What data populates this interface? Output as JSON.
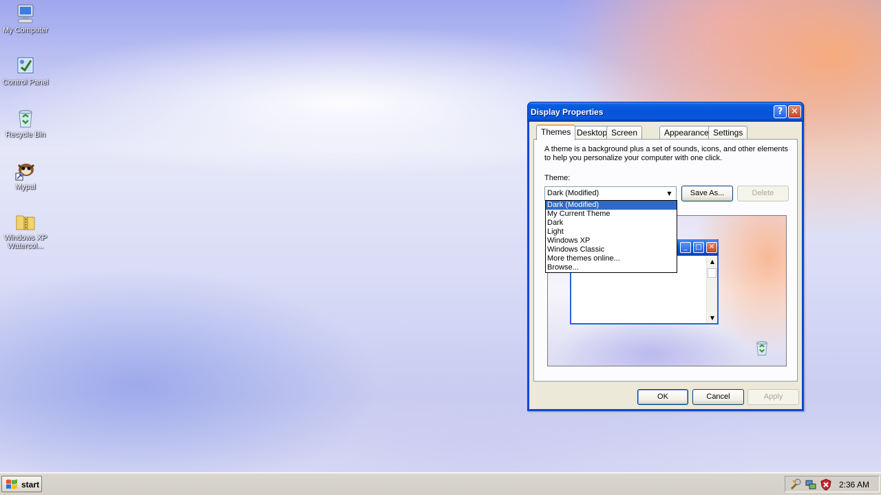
{
  "desktop": {
    "icons": [
      {
        "label": "My Computer",
        "icon": "computer-icon"
      },
      {
        "label": "Control Panel",
        "icon": "control-panel-icon"
      },
      {
        "label": "Recycle Bin",
        "icon": "recycle-bin-icon"
      },
      {
        "label": "Mypal",
        "icon": "mypal-icon"
      },
      {
        "label": "Windows XP Watercol...",
        "icon": "zip-folder-icon"
      }
    ]
  },
  "dialog": {
    "title": "Display Properties",
    "tabs": [
      "Themes",
      "Desktop",
      "Screen Saver",
      "Appearance",
      "Settings"
    ],
    "active_tab": "Themes",
    "description": "A theme is a background plus a set of sounds, icons, and other elements to help you personalize your computer with one click.",
    "theme_label": "Theme:",
    "theme_value": "Dark (Modified)",
    "save_as_label": "Save As...",
    "delete_label": "Delete",
    "theme_options": [
      "Dark (Modified)",
      "My Current Theme",
      "Dark",
      "Light",
      "Windows XP",
      "Windows Classic",
      "More themes online...",
      "Browse..."
    ],
    "ok_label": "OK",
    "cancel_label": "Cancel",
    "apply_label": "Apply"
  },
  "taskbar": {
    "start_label": "start",
    "clock": "2:36 AM"
  },
  "colors": {
    "titlebar": "#0553d9",
    "selection": "#316ac5",
    "dialog_bg": "#ece9d8"
  }
}
